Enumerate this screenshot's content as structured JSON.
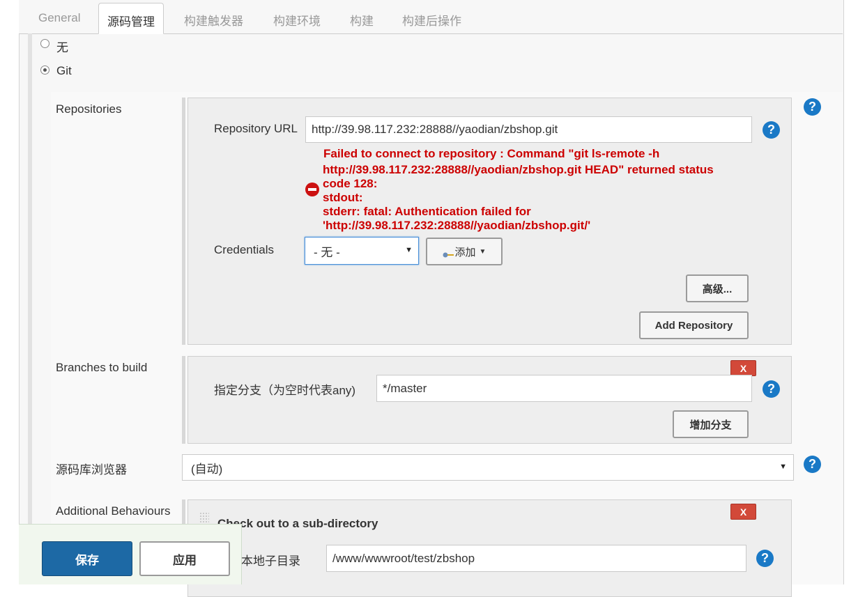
{
  "tabs": [
    "General",
    "源码管理",
    "构建触发器",
    "构建环境",
    "构建",
    "构建后操作"
  ],
  "scm": {
    "option_none": "无",
    "option_git": "Git",
    "selected": "Git"
  },
  "repositories": {
    "label": "Repositories",
    "url_label": "Repository URL",
    "url_value": "http://39.98.117.232:28888//yaodian/zbshop.git",
    "error_lines": [
      "Failed to connect to repository : Command \"git ls-remote -h",
      "http://39.98.117.232:28888//yaodian/zbshop.git HEAD\" returned status",
      "code 128:",
      "stdout:",
      "stderr: fatal: Authentication failed for",
      "'http://39.98.117.232:28888//yaodian/zbshop.git/'"
    ],
    "credentials_label": "Credentials",
    "credentials_value": "- 无 -",
    "add_button": "添加",
    "advanced_button": "高级...",
    "add_repository_button": "Add Repository"
  },
  "branches": {
    "label": "Branches to build",
    "delete_button": "X",
    "branch_label": "指定分支（为空时代表any)",
    "branch_value": "*/master",
    "add_branch_button": "增加分支"
  },
  "browser": {
    "label": "源码库浏览器",
    "value": "(自动)"
  },
  "behaviours": {
    "label": "Additional Behaviours",
    "delete_button": "X",
    "title": "Check out to a sub-directory",
    "subdir_label": "仓库的本地子目录",
    "subdir_value": "/www/wwwroot/test/zbshop"
  },
  "footer": {
    "save": "保存",
    "apply": "应用"
  },
  "help_symbol": "?",
  "colors": {
    "error": "#cc0000",
    "primary": "#1d69a5",
    "help": "#1a79c6",
    "delete": "#d24939"
  }
}
